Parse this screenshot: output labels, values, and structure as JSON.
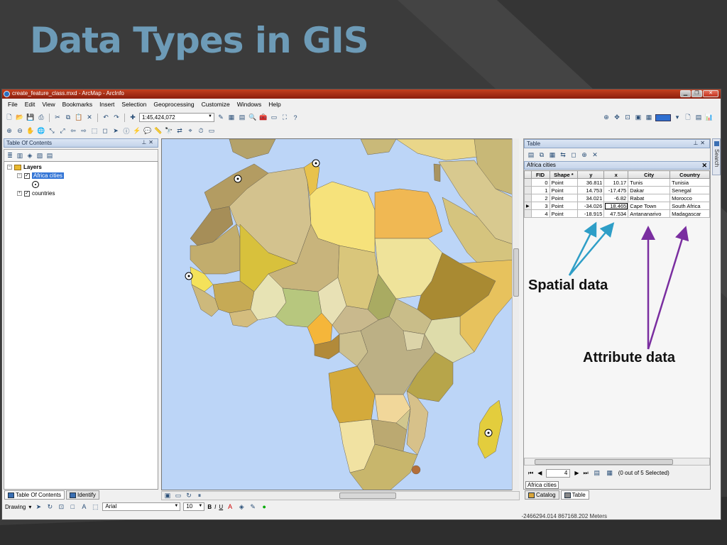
{
  "slide": {
    "title": "Data Types in GIS"
  },
  "window": {
    "title": "create_feature_class.mxd - ArcMap - ArcInfo",
    "controls": [
      "▁",
      "❐",
      "✕"
    ]
  },
  "menus": [
    "File",
    "Edit",
    "View",
    "Bookmarks",
    "Insert",
    "Selection",
    "Geoprocessing",
    "Customize",
    "Windows",
    "Help"
  ],
  "toolbar": {
    "scale": "1:45,424,072"
  },
  "toc": {
    "title": "Table Of Contents",
    "root": "Layers",
    "layer1": "Africa cities",
    "layer2": "countries"
  },
  "left_tabs": {
    "toc": "Table Of Contents",
    "identify": "Identify"
  },
  "table_window": {
    "title": "Table",
    "tab_name": "Africa cities",
    "columns": [
      "FID",
      "Shape *",
      "y",
      "x",
      "City",
      "Country"
    ],
    "rows": [
      {
        "fid": "0",
        "shape": "Point",
        "y": "36.811",
        "x": "10.17",
        "city": "Tunis",
        "country": "Tunisia"
      },
      {
        "fid": "1",
        "shape": "Point",
        "y": "14.753",
        "x": "-17.475",
        "city": "Dakar",
        "country": "Senegal"
      },
      {
        "fid": "2",
        "shape": "Point",
        "y": "34.021",
        "x": "-6.82",
        "city": "Rabat",
        "country": "Morocco"
      },
      {
        "fid": "3",
        "shape": "Point",
        "y": "-34.026",
        "x": "18.465",
        "city": "Cape Town",
        "country": "South Africa"
      },
      {
        "fid": "4",
        "shape": "Point",
        "y": "-18.915",
        "x": "47.534",
        "city": "Antananarivo",
        "country": "Madagascar"
      }
    ],
    "record": "4",
    "selection": "(0 out of 5 Selected)",
    "doc_tab": "Africa cities",
    "bottom_tabs": {
      "catalog": "Catalog",
      "table": "Table"
    },
    "side_tab": "Search"
  },
  "drawing": {
    "label": "Drawing",
    "font": "Arial",
    "size": "10",
    "bold": "B",
    "italic": "I",
    "underline": "U"
  },
  "status": {
    "coords": "-2466294.014  867168.202 Meters"
  },
  "annotations": {
    "spatial": "Spatial data",
    "attribute": "Attribute data"
  },
  "colors": {
    "title": "#6d9bb7",
    "spatial_arrow": "#2e9ec7",
    "attribute_arrow": "#7a2ea0",
    "ocean": "#bcd5f7"
  }
}
